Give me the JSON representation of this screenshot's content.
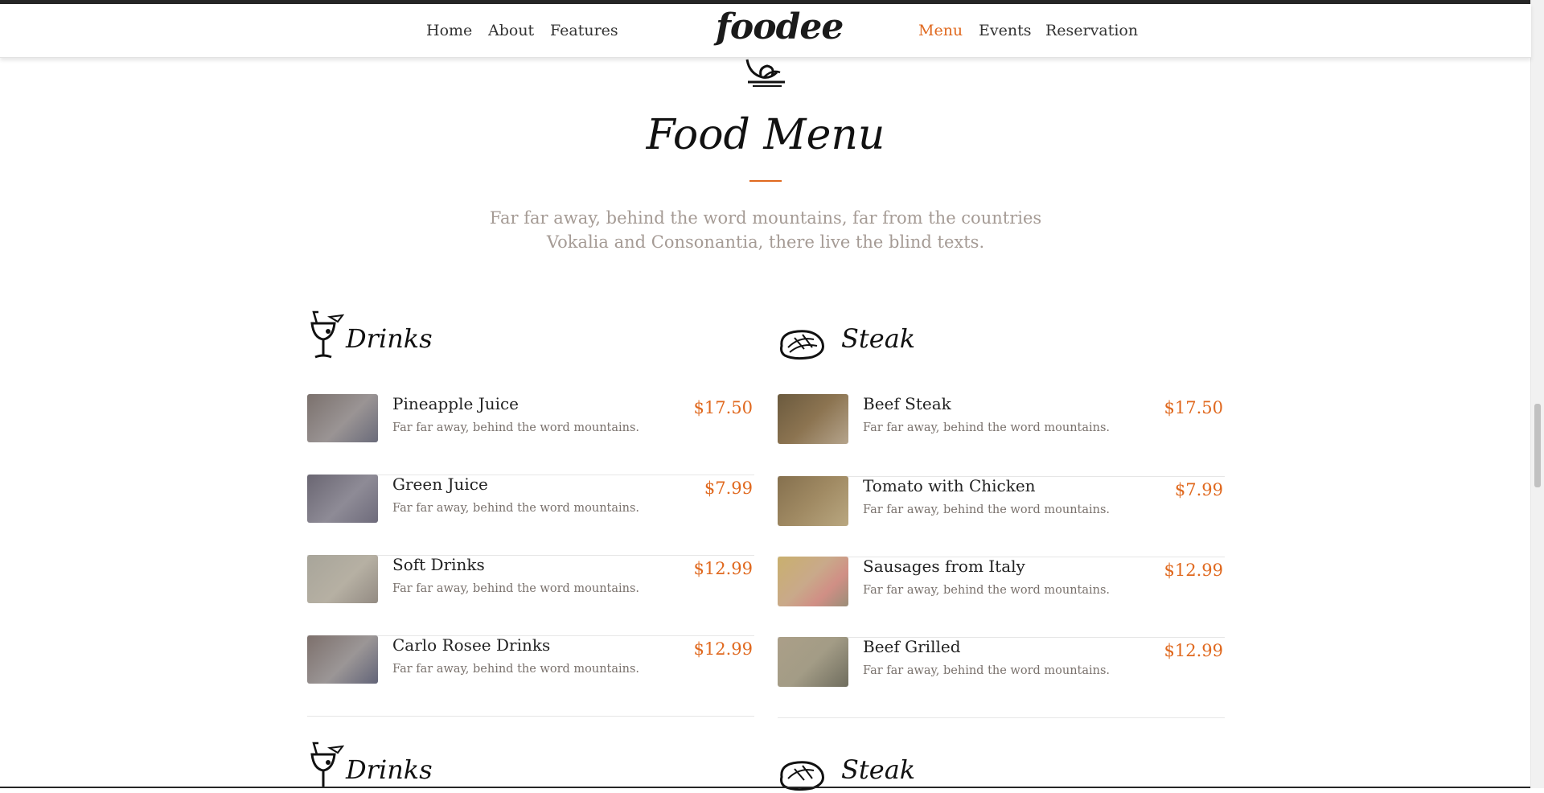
{
  "nav": {
    "brand": "foodee",
    "left_links": [
      "Home",
      "About",
      "Features"
    ],
    "right_links": [
      "Menu",
      "Events",
      "Reservation"
    ],
    "active": "Menu"
  },
  "section": {
    "title": "Food Menu",
    "description": "Far far away, behind the word mountains, far from the countries Vokalia and Consonantia, there live the blind texts."
  },
  "categories": [
    {
      "title": "Drinks",
      "icon": "cocktail-icon",
      "items": [
        {
          "name": "Pineapple Juice",
          "desc": "Far far away, behind the word mountains.",
          "price": "$17.50"
        },
        {
          "name": "Green Juice",
          "desc": "Far far away, behind the word mountains.",
          "price": "$7.99"
        },
        {
          "name": "Soft Drinks",
          "desc": "Far far away, behind the word mountains.",
          "price": "$12.99"
        },
        {
          "name": "Carlo Rosee Drinks",
          "desc": "Far far away, behind the word mountains.",
          "price": "$12.99"
        }
      ]
    },
    {
      "title": "Steak",
      "icon": "steak-icon",
      "items": [
        {
          "name": "Beef Steak",
          "desc": "Far far away, behind the word mountains.",
          "price": "$17.50"
        },
        {
          "name": "Tomato with Chicken",
          "desc": "Far far away, behind the word mountains.",
          "price": "$7.99"
        },
        {
          "name": "Sausages from Italy",
          "desc": "Far far away, behind the word mountains.",
          "price": "$12.99"
        },
        {
          "name": "Beef Grilled",
          "desc": "Far far away, behind the word mountains.",
          "price": "$12.99"
        }
      ]
    },
    {
      "title": "Drinks",
      "icon": "cocktail-icon"
    },
    {
      "title": "Steak",
      "icon": "steak-icon"
    }
  ],
  "colors": {
    "accent": "#e0691f",
    "muted_text": "#a59b95",
    "heading": "#111111"
  }
}
